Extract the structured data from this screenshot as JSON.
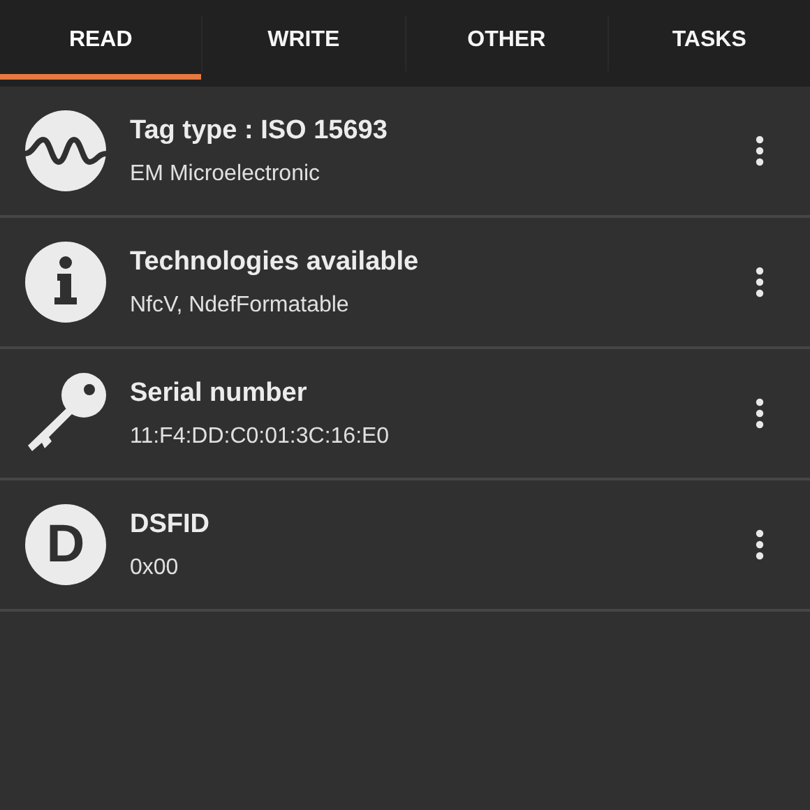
{
  "tabs": [
    {
      "label": "READ",
      "selected": true
    },
    {
      "label": "WRITE",
      "selected": false
    },
    {
      "label": "OTHER",
      "selected": false
    },
    {
      "label": "TASKS",
      "selected": false
    }
  ],
  "records": [
    {
      "kind": "wave",
      "title": "Tag type : ISO 15693",
      "value": "EM Microelectronic"
    },
    {
      "kind": "info",
      "title": "Technologies available",
      "value": "NfcV, NdefFormatable"
    },
    {
      "kind": "key",
      "title": "Serial number",
      "value": "11:F4:DD:C0:01:3C:16:E0"
    },
    {
      "kind": "letter",
      "badge": "D",
      "title": "DSFID",
      "value": "0x00"
    }
  ]
}
